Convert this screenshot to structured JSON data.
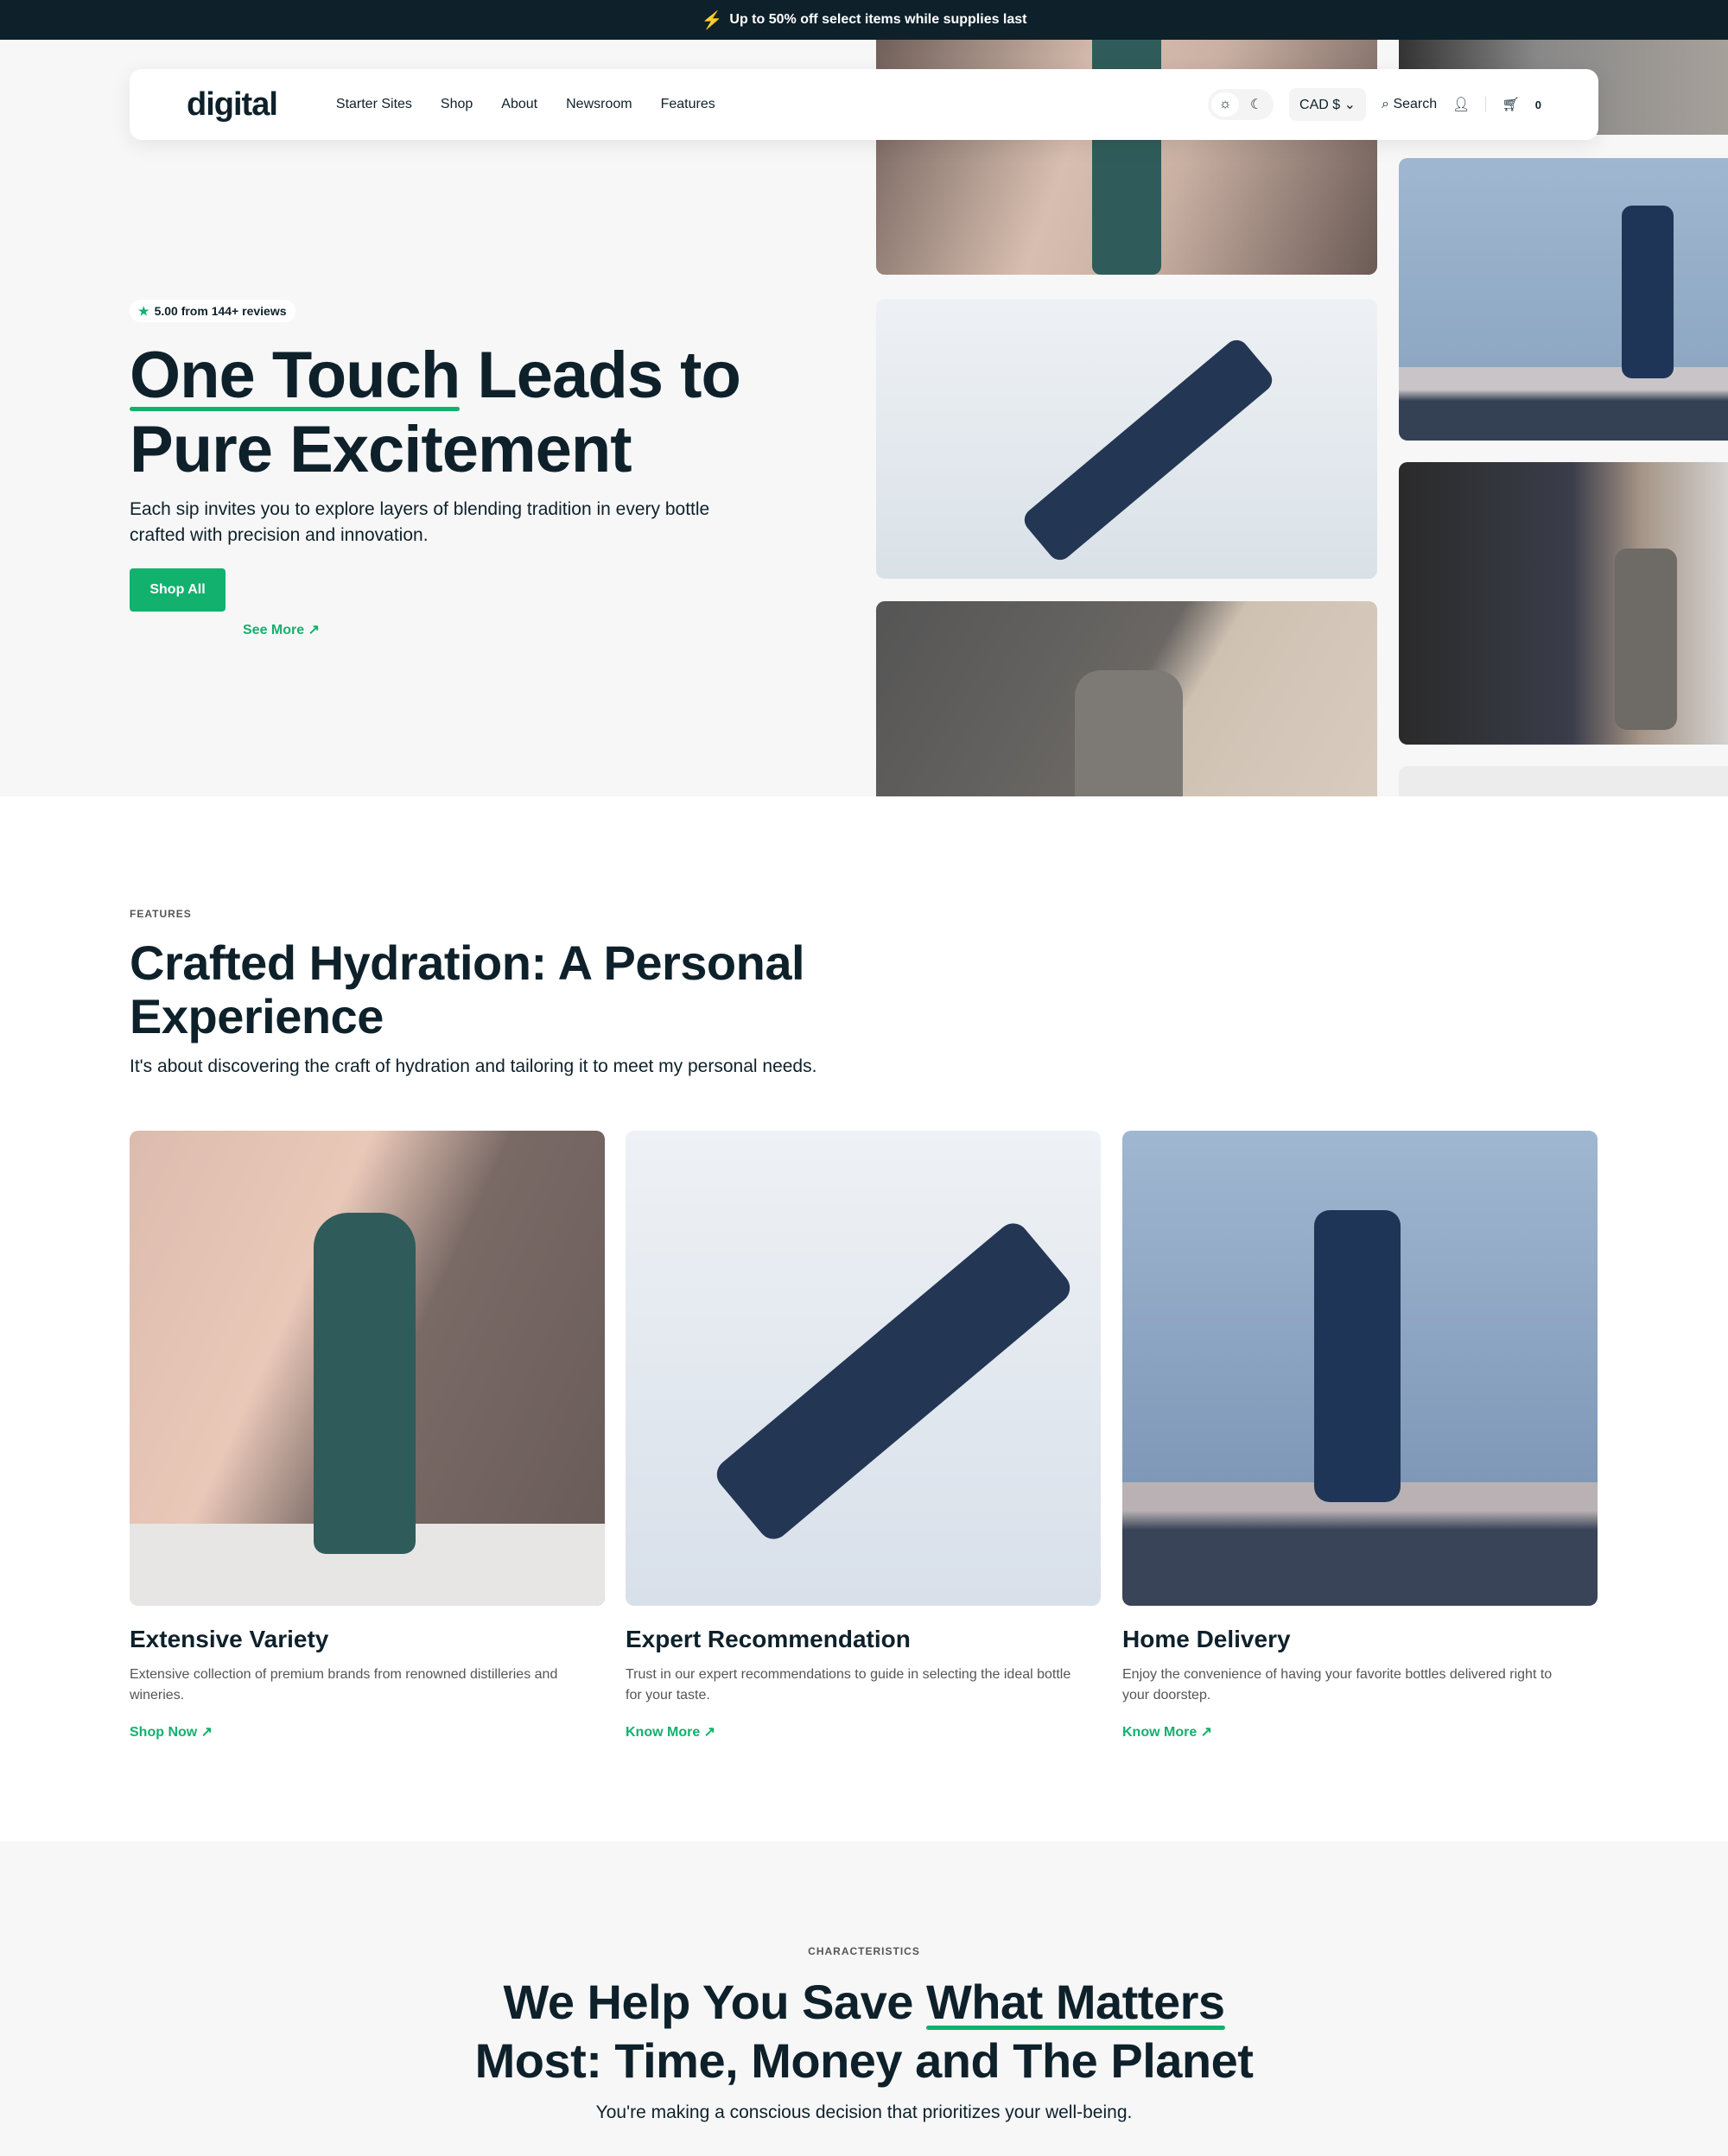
{
  "announcement": {
    "icon": "lightning-icon",
    "text": "Up to 50% off select items while supplies last"
  },
  "nav": {
    "logo": "digital",
    "links": [
      "Starter Sites",
      "Shop",
      "About",
      "Newsroom",
      "Features"
    ],
    "currency": "CAD $",
    "search": "Search",
    "cart_count": "0"
  },
  "hero": {
    "badge": "5.00 from 144+ reviews",
    "title_underlined": "One Touch",
    "title_rest1": " Leads to",
    "title_line2": "Pure Excitement",
    "lead": "Each sip invites you to explore layers of blending tradition in every bottle crafted with precision and innovation.",
    "primary": "Shop All",
    "secondary": "See More ↗"
  },
  "features": {
    "label": "FEATURES",
    "title": "Crafted Hydration: A Personal Experience",
    "subtitle": "It's about discovering the craft of hydration and tailoring it to meet my personal needs.",
    "cards": [
      {
        "title": "Extensive Variety",
        "desc": "Extensive collection of premium brands from renowned distilleries and wineries.",
        "link": "Shop Now ↗"
      },
      {
        "title": "Expert Recommendation",
        "desc": "Trust in our expert recommendations to guide in selecting the ideal bottle for your taste.",
        "link": "Know More ↗"
      },
      {
        "title": "Home Delivery",
        "desc": "Enjoy the convenience of having your favorite bottles delivered right to your doorstep.",
        "link": "Know More ↗"
      }
    ]
  },
  "characteristics": {
    "label": "CHARACTERISTICS",
    "title_pre": "We Help You Save ",
    "title_underlined": "What Matters",
    "title_line2": "Most: Time, Money and The Planet",
    "subtitle": "You're making a conscious decision that prioritizes your well-being."
  },
  "colors": {
    "accent": "#12b16e",
    "dark": "#0e212b"
  }
}
